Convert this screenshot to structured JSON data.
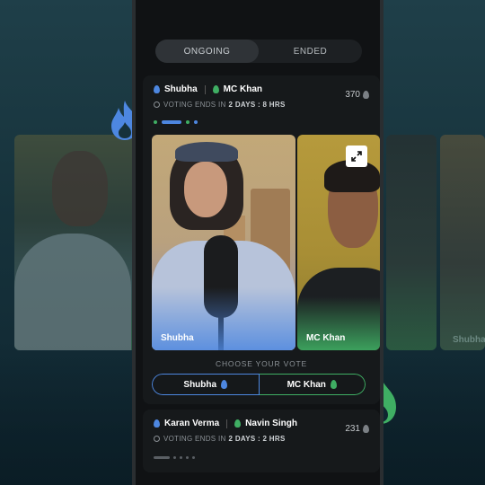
{
  "tabs": [
    {
      "label": "ONGOING",
      "active": true
    },
    {
      "label": "ENDED",
      "active": false
    }
  ],
  "battle1": {
    "player1": "Shubha",
    "player2": "MC Khan",
    "voting_prefix": "VOTING ENDS IN",
    "voting_time": "2 DAYS : 8 HRS",
    "votes": "370",
    "video1_label": "Shubha",
    "video2_label": "MC Khan",
    "choose_label": "CHOOSE YOUR VOTE",
    "vote_left": "Shubha",
    "vote_right": "MC Khan"
  },
  "battle2": {
    "player1": "Karan Verma",
    "player2": "Navin Singh",
    "voting_prefix": "VOTING ENDS IN",
    "voting_time": "2 DAYS : 2 HRS",
    "votes": "231"
  },
  "side_labels": {
    "right_far": "Shubha"
  },
  "colors": {
    "blue": "#4d87e0",
    "green": "#3fae63",
    "background": "#1f3f49"
  },
  "icons": [
    "flame-icon",
    "clock-icon",
    "expand-icon"
  ]
}
